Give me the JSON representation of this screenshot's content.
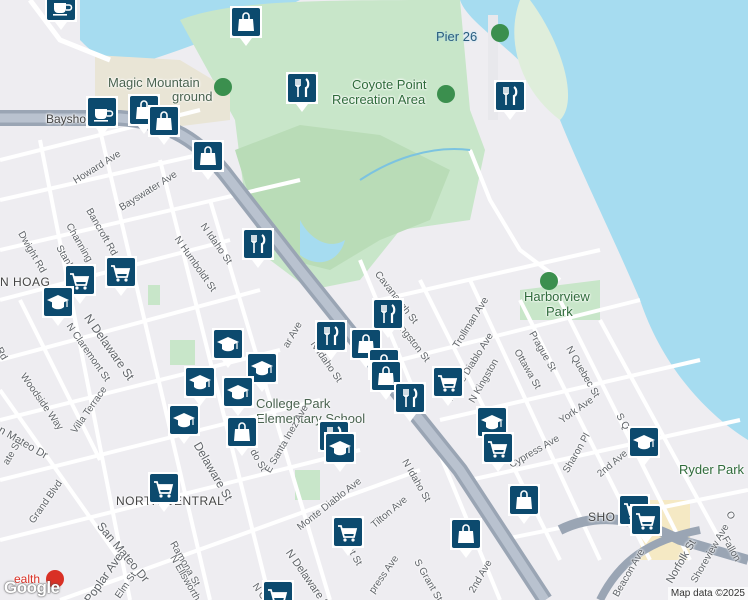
{
  "map": {
    "colors": {
      "water": "#a6dcf0",
      "park": "#c8e6c9",
      "land": "#eeedf1",
      "freeway": "#9aa5b4",
      "marker": "#0c4a6e"
    },
    "poi_labels": [
      {
        "id": "pier-26",
        "text": "Pier 26"
      },
      {
        "id": "coyote-point-1",
        "text": "Coyote Point"
      },
      {
        "id": "coyote-point-2",
        "text": "Recreation Area"
      },
      {
        "id": "magic-mountain-1",
        "text": "Magic Mountain"
      },
      {
        "id": "magic-mountain-2",
        "text": "ground"
      },
      {
        "id": "harborview-1",
        "text": "Harborview"
      },
      {
        "id": "harborview-2",
        "text": "Park"
      },
      {
        "id": "ryder-park",
        "text": "Ryder Park"
      },
      {
        "id": "college-park-1",
        "text": "College Park"
      },
      {
        "id": "college-park-2",
        "text": "Elementary School"
      }
    ],
    "area_labels": [
      {
        "id": "hoag",
        "text": "N HOAG"
      },
      {
        "id": "north-central",
        "text": "NORTH CENTRAL"
      },
      {
        "id": "shore",
        "text": "SHO"
      }
    ],
    "streets": [
      {
        "id": "bayshore",
        "text": "Bayshore"
      },
      {
        "id": "howard",
        "text": "Howard Ave"
      },
      {
        "id": "bayswater",
        "text": "Bayswater Ave"
      },
      {
        "id": "bancroft",
        "text": "Bancroft Rd"
      },
      {
        "id": "dwight",
        "text": "Dwight Rd"
      },
      {
        "id": "channing",
        "text": "Channing"
      },
      {
        "id": "stanley",
        "text": "Stanl"
      },
      {
        "id": "n-idaho-1",
        "text": "N Idaho St"
      },
      {
        "id": "n-humboldt",
        "text": "N Humboldt St"
      },
      {
        "id": "n-delaware",
        "text": "N Delaware St"
      },
      {
        "id": "n-claremont",
        "text": "N Claremont St"
      },
      {
        "id": "woodside",
        "text": "Woodside Way"
      },
      {
        "id": "villa",
        "text": "Villa Terrace"
      },
      {
        "id": "san-mateo-dr",
        "text": "n Mateo Dr"
      },
      {
        "id": "rd-left",
        "text": "Rd"
      },
      {
        "id": "ate-st",
        "text": "ate St"
      },
      {
        "id": "cavanaugh",
        "text": "Cavanaugh St"
      },
      {
        "id": "livingston",
        "text": "ngston St"
      },
      {
        "id": "trollman",
        "text": "Trollman Ave"
      },
      {
        "id": "prague",
        "text": "Prague St"
      },
      {
        "id": "n-quebec",
        "text": "N Quebec St"
      },
      {
        "id": "ottawa",
        "text": "Ottawa St"
      },
      {
        "id": "monte-diablo-1",
        "text": "Monte Diablo Ave"
      },
      {
        "id": "n-kingston",
        "text": "N Kingston"
      },
      {
        "id": "york",
        "text": "York Ave"
      },
      {
        "id": "s-quebec",
        "text": "S Q"
      },
      {
        "id": "cypress",
        "text": "Cypress Ave"
      },
      {
        "id": "sharon",
        "text": "Sharon Pl"
      },
      {
        "id": "2nd-ave-right",
        "text": "2nd Ave"
      },
      {
        "id": "ar-ave",
        "text": "ar Ave"
      },
      {
        "id": "n-idaho-2",
        "text": "N Idaho St"
      },
      {
        "id": "n-idaho-3",
        "text": "N Idaho St"
      },
      {
        "id": "do-st",
        "text": "do St"
      },
      {
        "id": "delaware",
        "text": "Delaware St"
      },
      {
        "id": "e-santa-inez",
        "text": "E Santa Inez Ave"
      },
      {
        "id": "monte-diablo-2",
        "text": "Monte Diablo Ave"
      },
      {
        "id": "tilton",
        "text": "Tilton Ave"
      },
      {
        "id": "n-delaware-2",
        "text": "N Delaware St"
      },
      {
        "id": "ont-st",
        "text": "ont St"
      },
      {
        "id": "press-ave",
        "text": "press Ave"
      },
      {
        "id": "s-grant",
        "text": "S Grant St"
      },
      {
        "id": "2nd-ave",
        "text": "2nd Ave"
      },
      {
        "id": "grand-blvd",
        "text": "Grand Blvd"
      },
      {
        "id": "ramona",
        "text": "Ramona St"
      },
      {
        "id": "n-ellsworth",
        "text": "N Ellsworth Ave"
      },
      {
        "id": "san-mateo-dr-2",
        "text": "San Mateo Dr"
      },
      {
        "id": "poplar",
        "text": "Poplar Ave"
      },
      {
        "id": "elm",
        "text": "Elm St"
      },
      {
        "id": "n-c",
        "text": "N C"
      },
      {
        "id": "beacon",
        "text": "Beacon Ave"
      },
      {
        "id": "norfolk",
        "text": "Norfolk St"
      },
      {
        "id": "shoreview",
        "text": "Shoreview Ave"
      },
      {
        "id": "fallon",
        "text": "Fallon"
      },
      {
        "id": "o-st",
        "text": "O"
      }
    ],
    "markers": [
      {
        "id": "m1",
        "icon": "coffee"
      },
      {
        "id": "m2",
        "icon": "shopping-bag"
      },
      {
        "id": "m3",
        "icon": "restaurant"
      },
      {
        "id": "m4",
        "icon": "restaurant"
      },
      {
        "id": "m5",
        "icon": "coffee"
      },
      {
        "id": "m6",
        "icon": "shopping-bag"
      },
      {
        "id": "m7",
        "icon": "shopping-bag"
      },
      {
        "id": "m8",
        "icon": "shopping-bag"
      },
      {
        "id": "m9",
        "icon": "restaurant"
      },
      {
        "id": "m10",
        "icon": "shopping-cart"
      },
      {
        "id": "m11",
        "icon": "shopping-cart"
      },
      {
        "id": "m12",
        "icon": "school"
      },
      {
        "id": "m13",
        "icon": "restaurant"
      },
      {
        "id": "m14",
        "icon": "restaurant"
      },
      {
        "id": "m15",
        "icon": "shopping-bag"
      },
      {
        "id": "m16",
        "icon": "school"
      },
      {
        "id": "m17",
        "icon": "school"
      },
      {
        "id": "m18",
        "icon": "shopping-bag"
      },
      {
        "id": "m19",
        "icon": "shopping-bag"
      },
      {
        "id": "m20",
        "icon": "school"
      },
      {
        "id": "m21",
        "icon": "school"
      },
      {
        "id": "m22",
        "icon": "school"
      },
      {
        "id": "m23",
        "icon": "restaurant"
      },
      {
        "id": "m24",
        "icon": "shopping-cart"
      },
      {
        "id": "m25",
        "icon": "shopping-bag"
      },
      {
        "id": "m26",
        "icon": "restaurant"
      },
      {
        "id": "m27",
        "icon": "school"
      },
      {
        "id": "m28",
        "icon": "school"
      },
      {
        "id": "m29",
        "icon": "shopping-cart"
      },
      {
        "id": "m30",
        "icon": "shopping-cart"
      },
      {
        "id": "m31",
        "icon": "school"
      },
      {
        "id": "m32",
        "icon": "shopping-cart"
      },
      {
        "id": "m33",
        "icon": "shopping-bag"
      },
      {
        "id": "m34",
        "icon": "shopping-bag"
      },
      {
        "id": "m35",
        "icon": "shopping-cart"
      },
      {
        "id": "m36",
        "icon": "shopping-cart"
      },
      {
        "id": "m37",
        "icon": "shopping-cart"
      }
    ],
    "logo_text": "Google",
    "hospital_text": "ealth",
    "attribution": "Map data ©2025"
  }
}
